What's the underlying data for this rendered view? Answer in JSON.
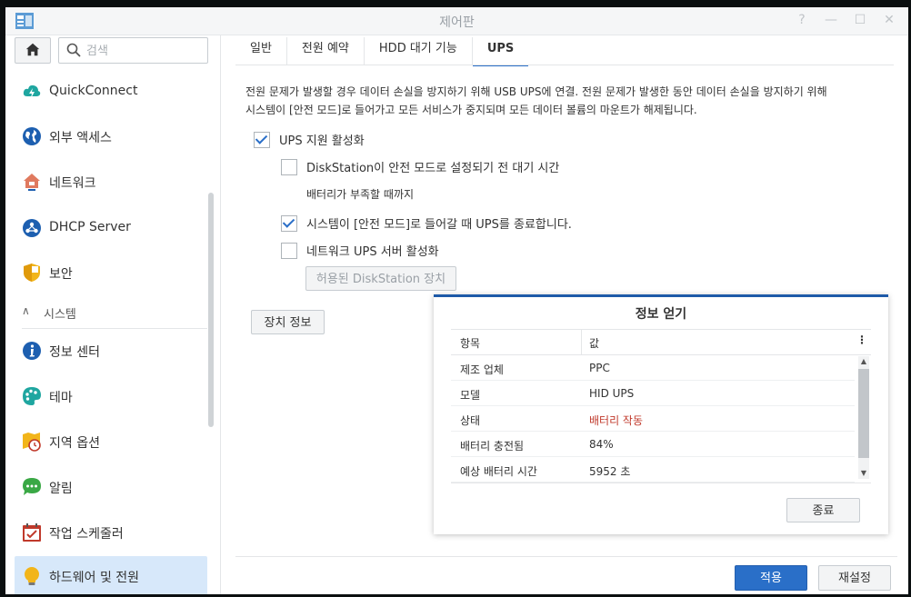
{
  "window": {
    "title": "제어판"
  },
  "sidebar": {
    "search_placeholder": "검색",
    "section_label": "시스템",
    "items": [
      {
        "label": "QuickConnect",
        "icon": "quickconnect-icon"
      },
      {
        "label": "외부 액세스",
        "icon": "globe-icon"
      },
      {
        "label": "네트워크",
        "icon": "house-network-icon"
      },
      {
        "label": "DHCP Server",
        "icon": "dhcp-icon"
      },
      {
        "label": "보안",
        "icon": "shield-icon"
      },
      {
        "label": "정보 센터",
        "icon": "info-icon"
      },
      {
        "label": "테마",
        "icon": "palette-icon"
      },
      {
        "label": "지역 옵션",
        "icon": "map-clock-icon"
      },
      {
        "label": "알림",
        "icon": "chat-bubble-icon"
      },
      {
        "label": "작업 스케줄러",
        "icon": "calendar-check-icon"
      },
      {
        "label": "하드웨어 및 전원",
        "icon": "lightbulb-icon"
      }
    ]
  },
  "tabs": [
    "일반",
    "전원 예약",
    "HDD 대기 기능",
    "UPS"
  ],
  "ups": {
    "description_line1": "전원 문제가 발생할 경우 데이터 손실을 방지하기 위해 USB UPS에 연결. 전원 문제가 발생한 동안 데이터 손실을 방지하기 위해",
    "description_line2": "시스템이 [안전 모드]로 들어가고 모든 서비스가 중지되며 모든 데이터 볼륨의 마운트가 해제됩니다.",
    "enable_label": "UPS 지원 활성화",
    "safe_mode_wait_label": "DiskStation이 안전 모드로 설정되기 전 대기 시간",
    "until_low_battery": "배터리가 부족할 때까지",
    "shutdown_ups_label": "시스템이 [안전 모드]로 들어갈 때 UPS를 종료합니다.",
    "network_ups_label": "네트워크 UPS 서버 활성화",
    "permitted_devices_button": "허용된 DiskStation 장치",
    "device_info_button": "장치 정보"
  },
  "dialog": {
    "title": "정보 얻기",
    "col_item": "항목",
    "col_value": "값",
    "rows": [
      {
        "item": "제조 업체",
        "value": "PPC"
      },
      {
        "item": "모델",
        "value": "HID UPS"
      },
      {
        "item": "상태",
        "value": "배터리 작동"
      },
      {
        "item": "배터리 충전됨",
        "value": "84%"
      },
      {
        "item": "예상 배터리 시간",
        "value": "5952 초"
      }
    ],
    "close_button": "종료",
    "status_color": "#c0392b"
  },
  "footer": {
    "apply": "적용",
    "reset": "재설정"
  },
  "colors": {
    "accent": "#2a6fc8",
    "active_nav": "#d7e8fa"
  }
}
